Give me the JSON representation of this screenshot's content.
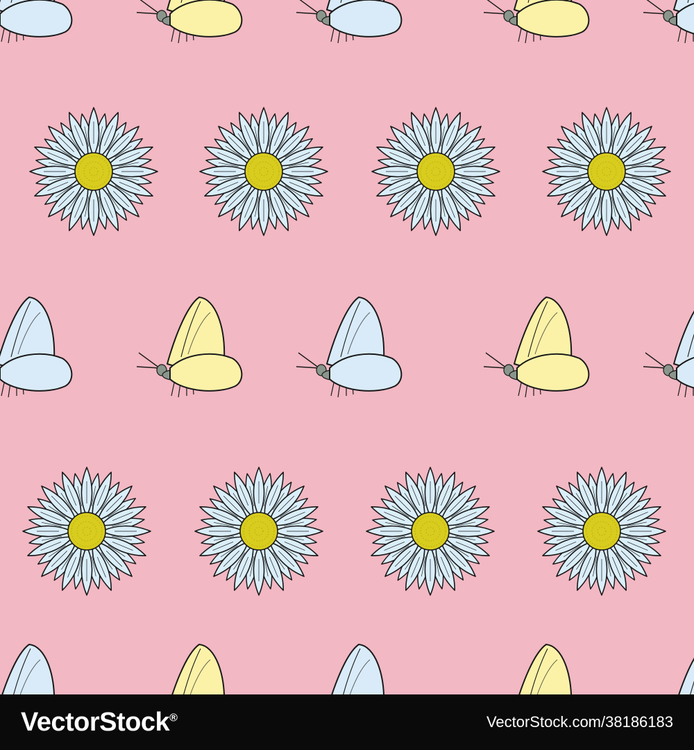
{
  "colors": {
    "background": "#f2b8c3",
    "daisy_petal": "#daeef9",
    "daisy_center": "#d8cc1e",
    "daisy_center_dark": "#a89a10",
    "butterfly_blue": "#d9ebf8",
    "butterfly_yellow": "#fbf2a8",
    "butterfly_body": "#8a968c",
    "outline": "#1a1a1a",
    "footer_bg": "#0a0a0a",
    "footer_text": "#ffffff"
  },
  "pattern": {
    "motifs": [
      "daisy-icon",
      "butterfly-icon"
    ],
    "butterfly_color_sequence": [
      "blue",
      "yellow",
      "blue",
      "yellow",
      "blue"
    ]
  },
  "watermark": {
    "left_text": "VectorStock",
    "left_registered": "®",
    "right_text": "VectorStock.com/38186183"
  }
}
